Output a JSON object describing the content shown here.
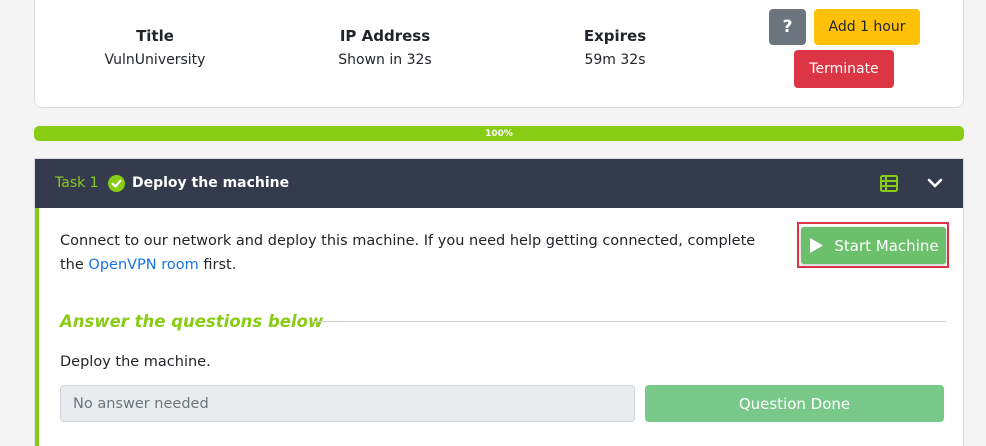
{
  "machine": {
    "title_label": "Title",
    "title_value": "VulnUniversity",
    "ip_label": "IP Address",
    "ip_value": "Shown in 32s",
    "expires_label": "Expires",
    "expires_value": "59m 32s",
    "help_label": "?",
    "add_hour_label": "Add 1 hour",
    "terminate_label": "Terminate"
  },
  "progress": {
    "value": 100,
    "label": "100%",
    "color": "#88cc14"
  },
  "task": {
    "number": "Task 1",
    "title": "Deploy the machine",
    "completed": true,
    "description_before": "Connect to our network and deploy this machine. If you need help getting connected, complete the ",
    "description_link": "OpenVPN room",
    "description_after": " first.",
    "start_label": "Start Machine",
    "answer_heading": "Answer the questions below",
    "question": "Deploy the machine.",
    "answer_placeholder": "No answer needed",
    "done_label": "Question Done"
  },
  "icons": {
    "check": "check-circle-icon",
    "tasklist": "task-list-icon",
    "chevron": "chevron-down-icon",
    "play": "play-icon"
  },
  "colors": {
    "accent": "#88cc14",
    "header_bg": "#333b4d",
    "danger": "#dc3545",
    "warning": "#ffc107",
    "success": "#6cc06c",
    "link": "#1a73e8"
  }
}
